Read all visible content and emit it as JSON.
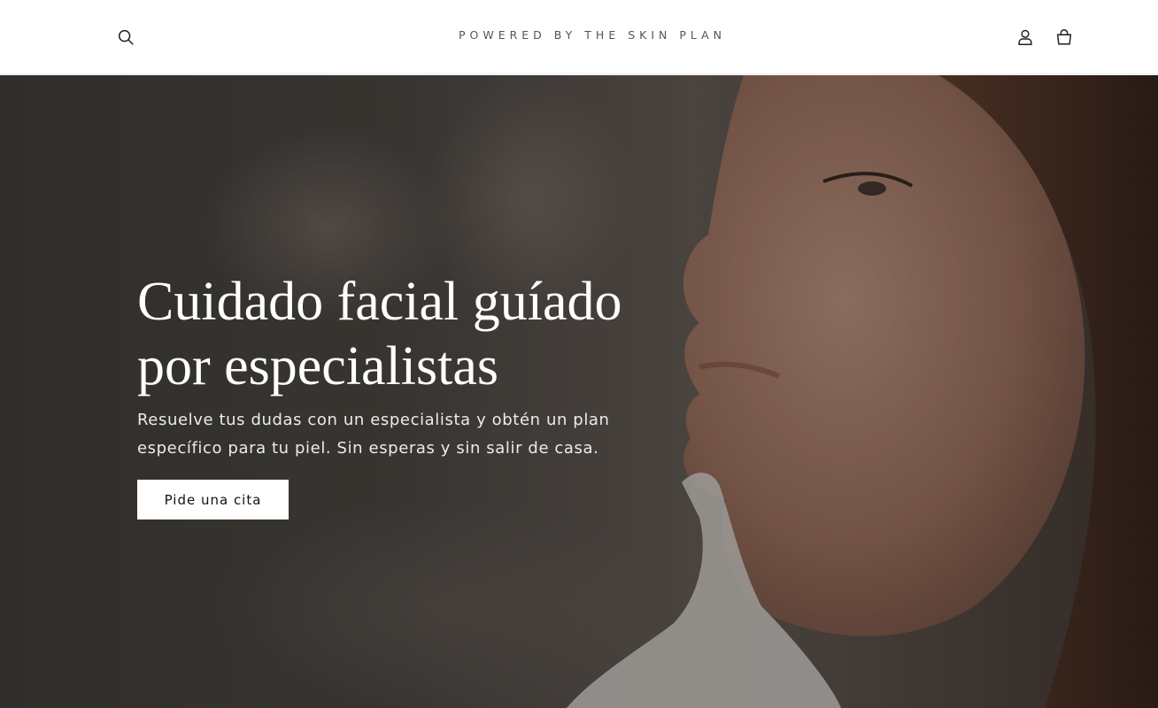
{
  "header": {
    "logo_text": "POWERED BY THE SKIN PLAN",
    "icons": {
      "search": "search-icon",
      "account": "user-icon",
      "cart": "cart-icon"
    }
  },
  "hero": {
    "title": "Cuidado facial guíado por especialistas",
    "subtitle": "Resuelve tus dudas con un especialista y obtén un plan específico para tu piel. Sin esperas y sin salir de casa.",
    "cta_label": "Pide una cita"
  },
  "colors": {
    "header_bg": "#ffffff",
    "text_dark": "#1f1f1f",
    "hero_text": "#ffffff",
    "button_bg": "#ffffff"
  }
}
